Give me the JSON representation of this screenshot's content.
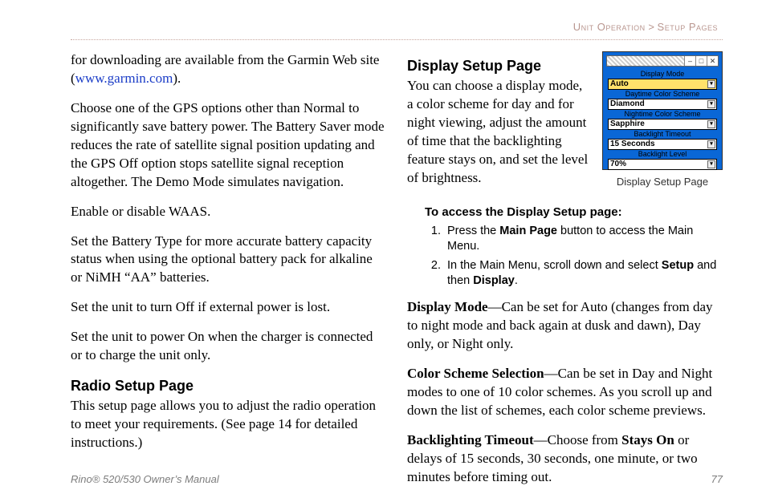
{
  "breadcrumb": {
    "section": "Unit Operation",
    "sep": ">",
    "sub": "Setup Pages"
  },
  "left": {
    "p1a": "for downloading are available from the Garmin Web site (",
    "link": "www.garmin.com",
    "p1b": ").",
    "p2": "Choose one of the GPS options other than Normal to significantly save battery power. The Battery Saver mode reduces the rate of satellite signal position updating and the GPS Off option stops satellite signal reception altogether. The Demo Mode simulates navigation.",
    "p3": "Enable or disable WAAS.",
    "p4": "Set the Battery Type for more accurate battery capacity status when using the optional battery pack for alkaline or NiMH “AA” batteries.",
    "p5": "Set the unit to turn Off if external power is lost.",
    "p6": "Set the unit to power On when the charger is connected or to charge the unit only.",
    "radio_h": "Radio Setup Page",
    "radio_p": "This setup page allows you to adjust the radio operation to meet your requirements. (See page 14 for detailed instructions.)"
  },
  "right": {
    "display_h": "Display Setup Page",
    "intro": "You can choose a display mode, a color scheme for day and for night viewing, adjust the amount of time that the backlighting feature stays on, and  set the level of brightness.",
    "device": {
      "labels": [
        "Display Mode",
        "Daytime Color Scheme",
        "Nightime Color Scheme",
        "Backlight Timeout",
        "Backlight Level"
      ],
      "values": [
        "Auto",
        "Diamond",
        "Sapphire",
        "15 Seconds",
        "70%"
      ]
    },
    "fig_caption": "Display Setup Page",
    "instr_head": "To access the Display Setup page:",
    "step1a": "Press the ",
    "step1b": "Main Page",
    "step1c": " button to access the Main Menu.",
    "step2a": "In the Main Menu, scroll down and select ",
    "step2b": "Setup",
    "step2c": " and then ",
    "step2d": "Display",
    "step2e": ".",
    "dm_term": "Display Mode",
    "dm_body": "—Can be set for Auto (changes from day to night mode and back again at dusk and dawn), Day only, or Night only.",
    "cs_term": "Color Scheme Selection",
    "cs_body": "—Can be set in Day and Night modes to one of 10 color schemes. As you scroll up and down the list of schemes, each color scheme previews.",
    "bt_term": "Backlighting Timeout",
    "bt_body1": "—Choose from ",
    "bt_body2": "Stays On",
    "bt_body3": " or delays of 15 seconds, 30 seconds, one minute, or two minutes before timing out."
  },
  "footer": {
    "left_a": "Rino",
    "left_b": "®",
    "left_c": " 520/530 Owner’s Manual",
    "page": "77"
  }
}
